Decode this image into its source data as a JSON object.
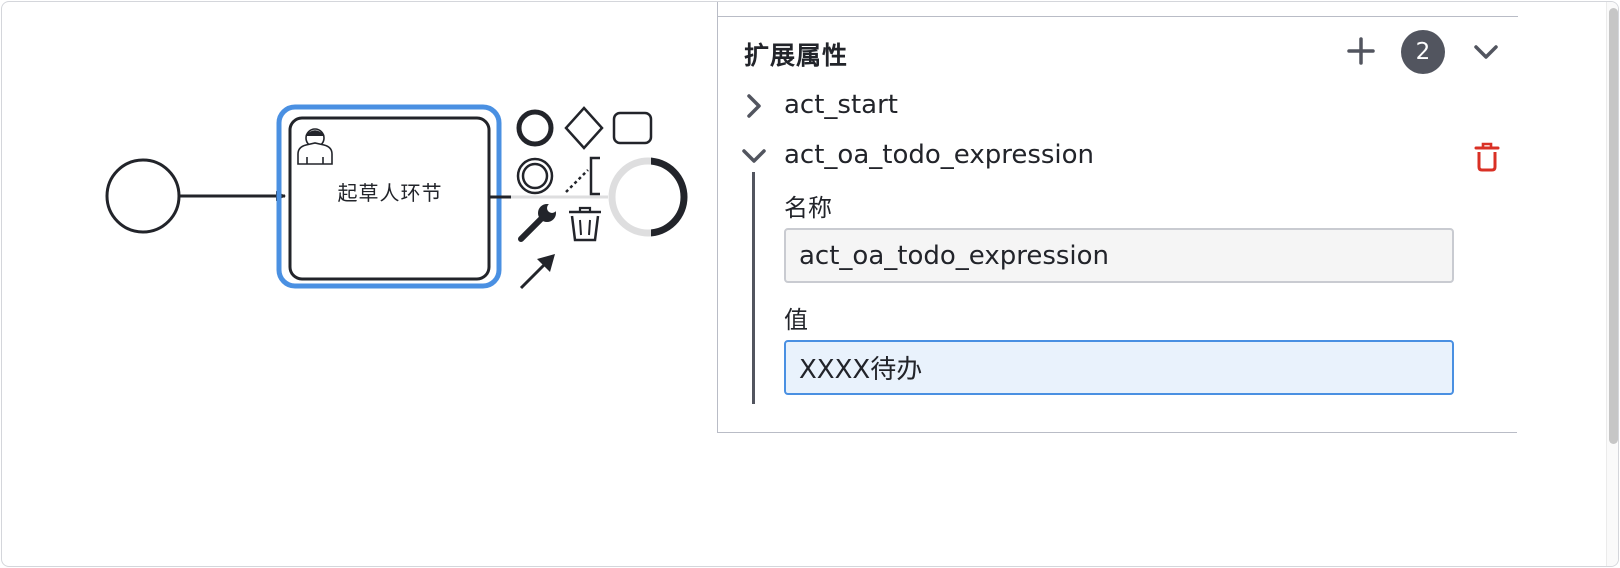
{
  "canvas": {
    "task": {
      "label": "起草人环节"
    },
    "context_pad": [
      {
        "name": "end-event-icon"
      },
      {
        "name": "gateway-icon"
      },
      {
        "name": "task-icon"
      },
      {
        "name": "intermediate-event-icon"
      },
      {
        "name": "text-annotation-icon"
      },
      {
        "name": "wrench-icon"
      },
      {
        "name": "trash-icon"
      },
      {
        "name": "connect-arrow-icon"
      }
    ]
  },
  "panel": {
    "group": {
      "title": "扩展属性",
      "count": "2",
      "add_icon": "plus-icon",
      "toggle_icon": "chevron-down-icon"
    },
    "entries": [
      {
        "label": "act_start",
        "expanded": false
      },
      {
        "label": "act_oa_todo_expression",
        "expanded": true
      }
    ],
    "fields": {
      "name_label": "名称",
      "name_value": "act_oa_todo_expression",
      "value_label": "值",
      "value_value": "XXXX待办"
    }
  },
  "colors": {
    "selection": "#4a90e2",
    "delete": "#d93025",
    "badge": "#52555f",
    "focused_input_bg": "#e9f2fc"
  }
}
